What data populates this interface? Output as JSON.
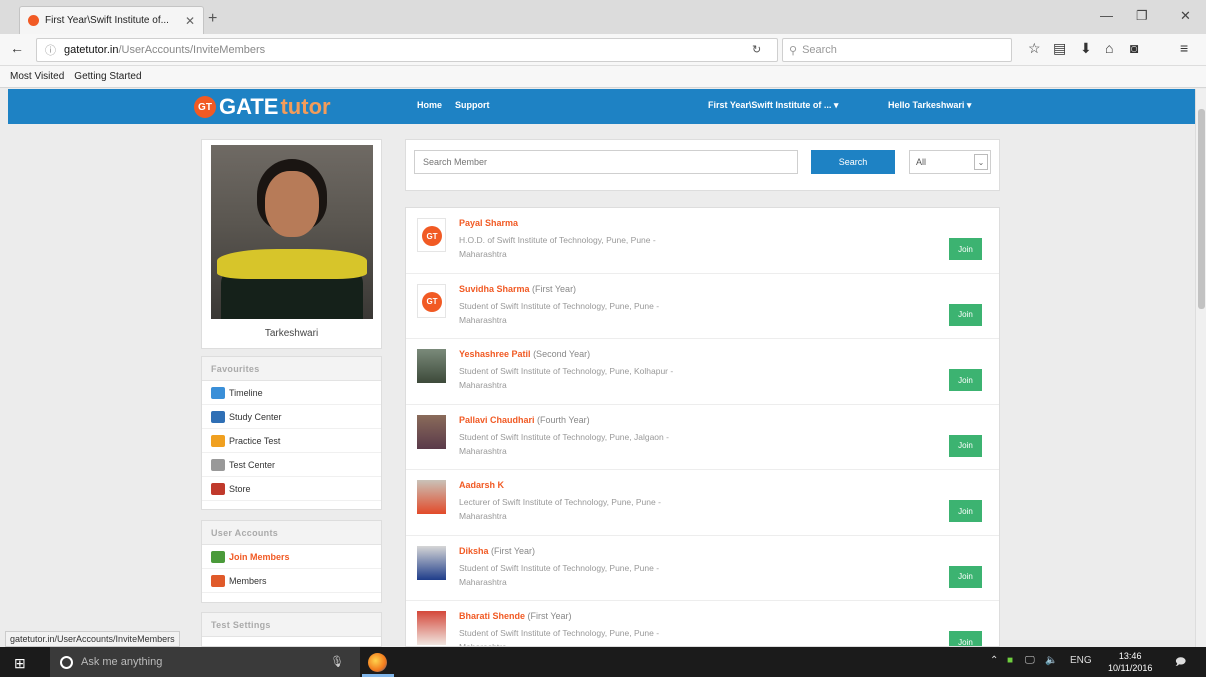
{
  "browser": {
    "tab_title": "First Year\\Swift Institute of...",
    "url_host": "gatetutor.in",
    "url_path": "/UserAccounts/InviteMembers",
    "search_placeholder": "Search",
    "bookmarks": [
      "Most Visited",
      "Getting Started"
    ],
    "status_url": "gatetutor.in/UserAccounts/InviteMembers"
  },
  "header": {
    "logo_badge": "GT",
    "logo_gate": "GATE",
    "logo_tutor": "tutor",
    "nav_home": "Home",
    "nav_support": "Support",
    "institute_menu": "First Year\\Swift Institute of ... ▾",
    "user_menu": "Hello Tarkeshwari ▾"
  },
  "profile": {
    "name": "Tarkeshwari"
  },
  "favourites": {
    "heading": "Favourites",
    "items": [
      {
        "label": "Timeline",
        "color": "#3a8fd8"
      },
      {
        "label": "Study Center",
        "color": "#2f6fb5"
      },
      {
        "label": "Practice Test",
        "color": "#f0a020"
      },
      {
        "label": "Test Center",
        "color": "#999999"
      },
      {
        "label": "Store",
        "color": "#c0392b"
      }
    ]
  },
  "user_accounts": {
    "heading": "User Accounts",
    "items": [
      {
        "label": "Join Members",
        "color": "#4a9a3a"
      },
      {
        "label": "Members",
        "color": "#e05a2a"
      }
    ]
  },
  "test_settings": {
    "heading": "Test Settings"
  },
  "search": {
    "placeholder": "Search Member",
    "button": "Search",
    "filter": "All"
  },
  "join_label": "Join",
  "members": [
    {
      "name": "Payal Sharma",
      "year": "",
      "desc": "H.O.D. of Swift Institute of Technology, Pune, Pune - Maharashtra",
      "avatar": "gt"
    },
    {
      "name": "Suvidha Sharma",
      "year": "(First Year)",
      "desc": "Student of Swift Institute of Technology, Pune, Pune - Maharashtra",
      "avatar": "gt"
    },
    {
      "name": "Yeshashree Patil",
      "year": "(Second Year)",
      "desc": "Student of Swift Institute of Technology, Pune, Kolhapur - Maharashtra",
      "avatar": "photo-a"
    },
    {
      "name": "Pallavi Chaudhari",
      "year": "(Fourth Year)",
      "desc": "Student of Swift Institute of Technology, Pune, Jalgaon - Maharashtra",
      "avatar": "photo-b"
    },
    {
      "name": "Aadarsh K",
      "year": "",
      "desc": "Lecturer of Swift Institute of Technology, Pune, Pune - Maharashtra",
      "avatar": "photo-c"
    },
    {
      "name": "Diksha",
      "year": "(First Year)",
      "desc": "Student of Swift Institute of Technology, Pune, Pune - Maharashtra",
      "avatar": "photo-d"
    },
    {
      "name": "Bharati Shende",
      "year": "(First Year)",
      "desc": "Student of Swift Institute of Technology, Pune, Pune - Maharashtra",
      "avatar": "photo-e"
    }
  ],
  "taskbar": {
    "search_text": "Ask me anything",
    "lang": "ENG",
    "time": "13:46",
    "date": "10/11/2016"
  }
}
